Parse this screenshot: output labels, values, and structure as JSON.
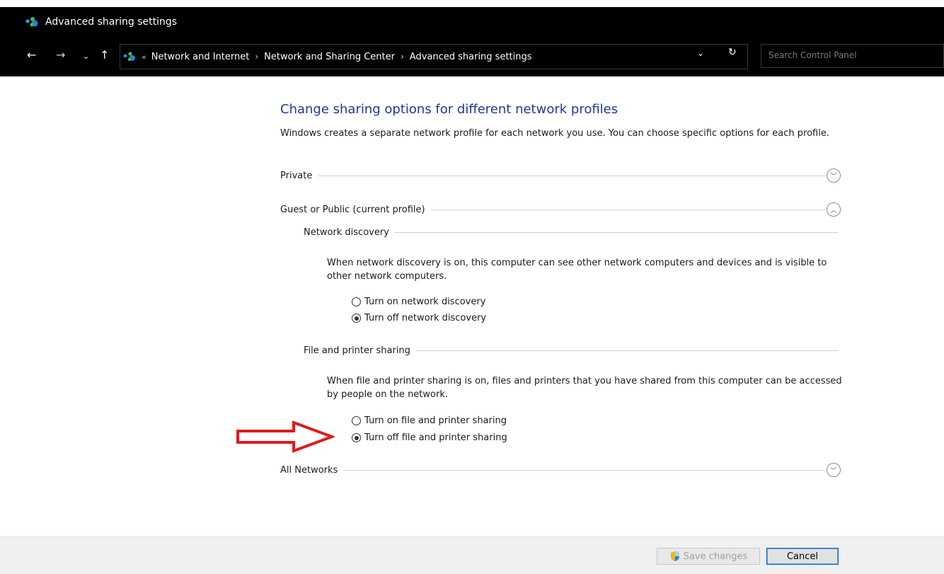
{
  "window": {
    "title": "Advanced sharing settings"
  },
  "nav": {
    "back_glyph": "←",
    "forward_glyph": "→",
    "recent_glyph": "⌄",
    "up_glyph": "↑",
    "lead_glyph": "«",
    "breadcrumbs": [
      "Network and Internet",
      "Network and Sharing Center",
      "Advanced sharing settings"
    ],
    "sep_glyph": "›",
    "dropdown_glyph": "⌄",
    "refresh_glyph": "↻",
    "search_placeholder": "Search Control Panel"
  },
  "main": {
    "heading": "Change sharing options for different network profiles",
    "intro": "Windows creates a separate network profile for each network you use. You can choose specific options for each profile.",
    "profiles": {
      "private": {
        "label": "Private",
        "expanded": false
      },
      "guest_public": {
        "label": "Guest or Public (current profile)",
        "expanded": true
      },
      "all_networks": {
        "label": "All Networks",
        "expanded": false
      }
    },
    "network_discovery": {
      "label": "Network discovery",
      "description": "When network discovery is on, this computer can see other network computers and devices and is visible to other network computers.",
      "options": [
        {
          "label": "Turn on network discovery",
          "checked": false
        },
        {
          "label": "Turn off network discovery",
          "checked": true
        }
      ]
    },
    "file_printer_sharing": {
      "label": "File and printer sharing",
      "description": "When file and printer sharing is on, files and printers that you have shared from this computer can be accessed by people on the network.",
      "options": [
        {
          "label": "Turn on file and printer sharing",
          "checked": false
        },
        {
          "label": "Turn off file and printer sharing",
          "checked": true
        }
      ]
    },
    "chevron_down_glyph": "﹀",
    "chevron_up_glyph": "︿"
  },
  "footer": {
    "save_label": "Save changes",
    "cancel_label": "Cancel"
  },
  "colors": {
    "heading_blue": "#1e3b94",
    "arrow_red": "#e01b1b",
    "titlebar_bg": "#000000"
  },
  "icons": {
    "app": "network-icon",
    "shield": "uac-shield-icon"
  }
}
